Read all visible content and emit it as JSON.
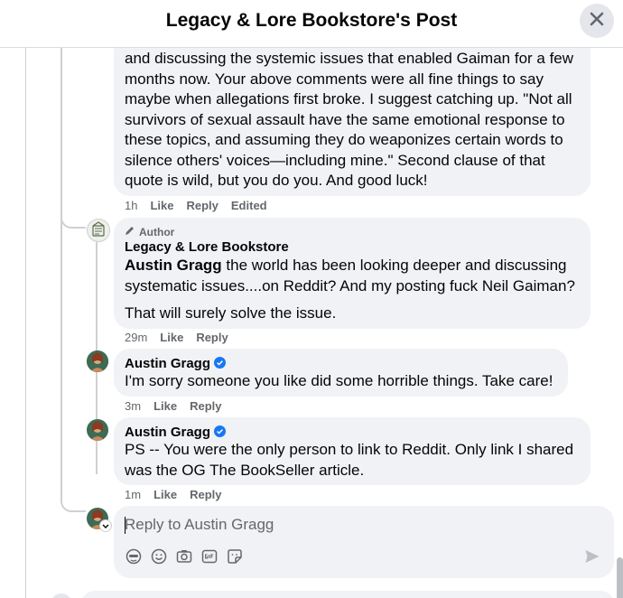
{
  "header": {
    "title": "Legacy & Lore Bookstore's Post"
  },
  "comments": [
    {
      "text": "and discussing the systemic issues that enabled Gaiman for a few months now. Your above comments were all fine things to say maybe when allegations first broke. I suggest catching up. \"Not all survivors of sexual assault have the same emotional response to these topics, and assuming they do weaponizes certain words to silence others' voices—including mine.\" Second clause of that quote is wild, but you do you. And good luck!",
      "time": "1h",
      "like": "Like",
      "reply": "Reply",
      "edited": "Edited"
    },
    {
      "badge": "Author",
      "author": "Legacy & Lore Bookstore",
      "mention": "Austin Gragg",
      "text": " the world has been looking deeper and discussing systematic issues....on Reddit? And my posting fuck Neil Gaiman?",
      "text2": "That will surely solve the issue.",
      "time": "29m",
      "like": "Like",
      "reply": "Reply"
    },
    {
      "author": "Austin Gragg",
      "text": "I'm sorry someone you like did some horrible things. Take care!",
      "time": "3m",
      "like": "Like",
      "reply": "Reply"
    },
    {
      "author": "Austin Gragg",
      "text": "PS -- You were the only person to link to Reddit. Only link I shared was the OG The BookSeller article.",
      "time": "1m",
      "like": "Like",
      "reply": "Reply"
    }
  ],
  "reply_box": {
    "placeholder": "Reply to Austin Gragg"
  },
  "icons": [
    "close-icon",
    "pencil-icon",
    "verified-icon",
    "avatar-icon",
    "emoji-icon",
    "camera-icon",
    "gif-icon",
    "sticker-icon",
    "send-icon"
  ],
  "colors": {
    "accent": "#1877f2",
    "bubble": "#f0f2f5",
    "secondary_text": "#65676b"
  }
}
